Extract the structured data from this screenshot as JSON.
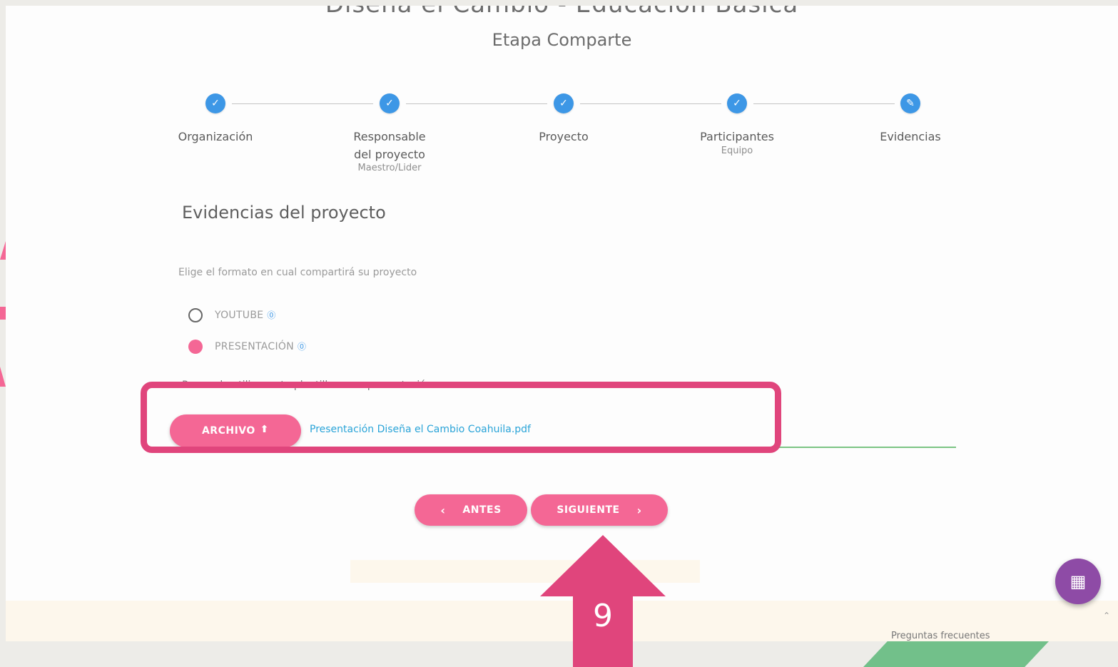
{
  "header": {
    "title": "Diseña el Cambio - Educación Básica",
    "stage": "Etapa Comparte"
  },
  "steps": [
    {
      "label": "Organización",
      "sub": "",
      "icon": "check-icon",
      "state": "done"
    },
    {
      "label": "Responsable del proyecto",
      "sub": "Maestro/Lider",
      "icon": "check-icon",
      "state": "done"
    },
    {
      "label": "Proyecto",
      "sub": "",
      "icon": "check-icon",
      "state": "done"
    },
    {
      "label": "Participantes",
      "sub": "Equipo",
      "icon": "check-icon",
      "state": "done"
    },
    {
      "label": "Evidencias",
      "sub": "",
      "icon": "pencil-icon",
      "state": "current"
    }
  ],
  "section": {
    "title": "Evidencias del proyecto",
    "prompt": "Elige el formato en cual compartirá su proyecto"
  },
  "options": [
    {
      "label": "YOUTUBE",
      "checked": false
    },
    {
      "label": "PRESENTACIÓN",
      "checked": true
    }
  ],
  "hint": "Recuerda utilizar esta plantilla en su presentación:",
  "upload": {
    "button_label": "ARCHIVO",
    "file_name": "Presentación Diseña el Cambio Coahuila.pdf"
  },
  "nav": {
    "back_label": "ANTES",
    "next_label": "SIGUIENTE"
  },
  "footer": {
    "link": "Preguntas frecuentes"
  },
  "annotation": {
    "step_number": "9"
  },
  "colors": {
    "accent_pink": "#f46795",
    "step_blue": "#3d97e6",
    "highlight": "#e0457c",
    "fab_purple": "#8e4ba6",
    "link_blue": "#2aa4d8",
    "underline_green": "#7cc483"
  }
}
